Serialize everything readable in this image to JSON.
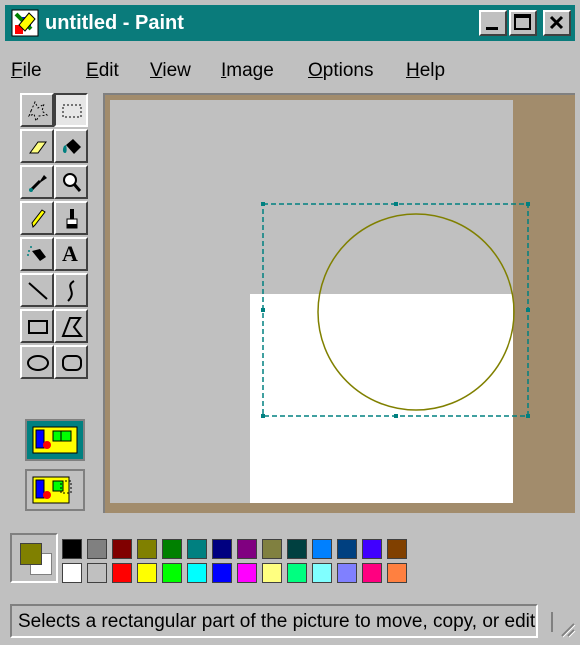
{
  "window": {
    "title": "untitled - Paint",
    "controls": [
      "minimize",
      "maximize",
      "close"
    ]
  },
  "menu": {
    "items": [
      {
        "label": "File",
        "hotkey": "F"
      },
      {
        "label": "Edit",
        "hotkey": "E"
      },
      {
        "label": "View",
        "hotkey": "V"
      },
      {
        "label": "Image",
        "hotkey": "I"
      },
      {
        "label": "Options",
        "hotkey": "O"
      },
      {
        "label": "Help",
        "hotkey": "H"
      }
    ]
  },
  "tools": [
    {
      "name": "free-form-select",
      "icon": "free-form-select-icon"
    },
    {
      "name": "select",
      "icon": "rect-select-icon",
      "selected": true
    },
    {
      "name": "eraser",
      "icon": "eraser-icon"
    },
    {
      "name": "fill-with-color",
      "icon": "fill-bucket-icon"
    },
    {
      "name": "pick-color",
      "icon": "eyedropper-icon"
    },
    {
      "name": "magnifier",
      "icon": "magnifier-icon"
    },
    {
      "name": "pencil",
      "icon": "pencil-icon"
    },
    {
      "name": "brush",
      "icon": "brush-icon"
    },
    {
      "name": "airbrush",
      "icon": "airbrush-icon"
    },
    {
      "name": "text",
      "icon": "text-icon",
      "glyph": "A"
    },
    {
      "name": "line",
      "icon": "line-icon"
    },
    {
      "name": "curve",
      "icon": "curve-icon"
    },
    {
      "name": "rectangle",
      "icon": "rectangle-icon"
    },
    {
      "name": "polygon",
      "icon": "polygon-icon"
    },
    {
      "name": "ellipse",
      "icon": "ellipse-icon"
    },
    {
      "name": "rounded-rectangle",
      "icon": "rounded-rectangle-icon"
    }
  ],
  "selection_options": [
    {
      "name": "opaque-selection",
      "selected": true
    },
    {
      "name": "transparent-selection",
      "selected": false
    }
  ],
  "palette": {
    "foreground": "#808000",
    "background": "#ffffff",
    "row1": [
      "#000000",
      "#808080",
      "#800000",
      "#808000",
      "#008000",
      "#008080",
      "#000080",
      "#800080",
      "#808040",
      "#004040",
      "#0080ff",
      "#004080",
      "#4000ff",
      "#804000"
    ],
    "row2": [
      "#ffffff",
      "#c0c0c0",
      "#ff0000",
      "#ffff00",
      "#00ff00",
      "#00ffff",
      "#0000ff",
      "#ff00ff",
      "#ffff80",
      "#00ff80",
      "#80ffff",
      "#8080ff",
      "#ff0080",
      "#ff8040"
    ]
  },
  "status": {
    "text": "Selects a rectangular part of the picture to move, copy, or edit."
  },
  "colors": {
    "title_bar": "#0a7b7b",
    "workspace": "#a28c6c",
    "selection_outline": "#008080",
    "circle_stroke": "#808000"
  }
}
